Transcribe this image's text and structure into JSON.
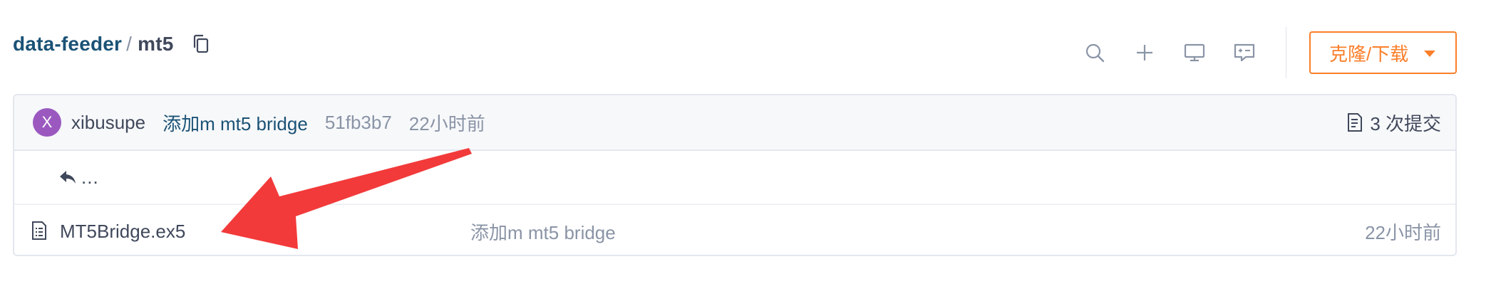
{
  "breadcrumb": {
    "repo": "data-feeder",
    "separator": "/",
    "current": "mt5"
  },
  "toolbar": {
    "icons": [
      "search-icon",
      "plus-icon",
      "monitor-icon",
      "comment-icon"
    ],
    "clone_label": "克隆/下载"
  },
  "commit": {
    "avatar_initial": "X",
    "avatar_color": "#9b59c0",
    "author": "xibusupe",
    "message": "添加m mt5 bridge",
    "hash": "51fb3b7",
    "time": "22小时前",
    "count_label": "3 次提交"
  },
  "back_row": {
    "label": "..."
  },
  "files": [
    {
      "name": "MT5Bridge.ex5",
      "commit_message": "添加m mt5 bridge",
      "time": "22小时前"
    }
  ],
  "colors": {
    "accent": "#fa7f2a",
    "link": "#1b5276",
    "muted": "#8a94a6",
    "annotation_arrow": "#f23a3a"
  }
}
